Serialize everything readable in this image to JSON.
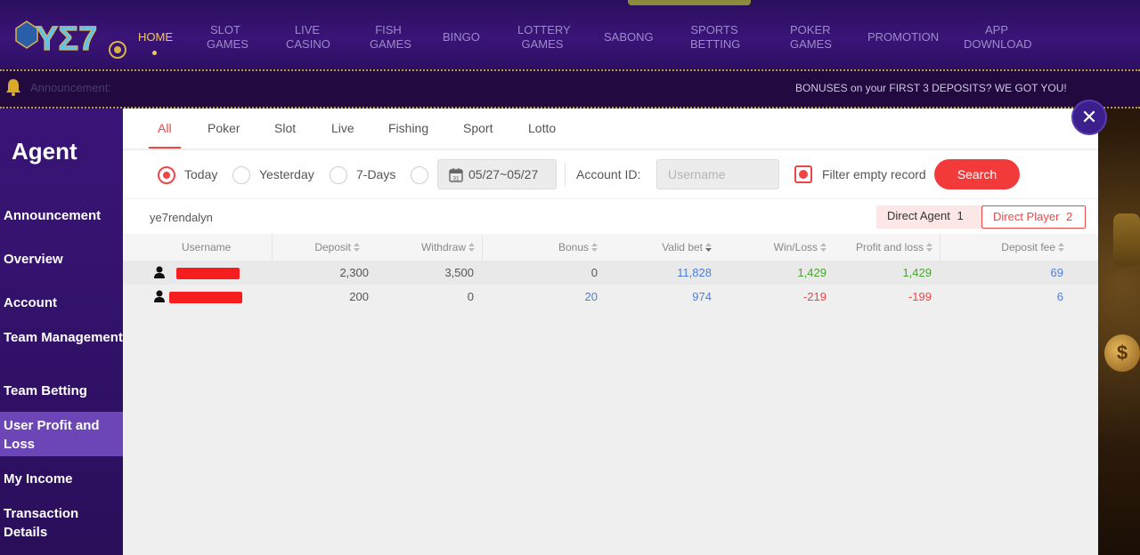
{
  "nav": {
    "items": [
      {
        "label": "HOME",
        "active": true
      },
      {
        "label": "SLOT GAMES"
      },
      {
        "label": "LIVE CASINO"
      },
      {
        "label": "FISH GAMES"
      },
      {
        "label": "BINGO"
      },
      {
        "label": "LOTTERY GAMES"
      },
      {
        "label": "SABONG"
      },
      {
        "label": "SPORTS BETTING"
      },
      {
        "label": "POKER GAMES"
      },
      {
        "label": "PROMOTION"
      },
      {
        "label": "APP DOWNLOAD"
      }
    ]
  },
  "announcement": {
    "label": "Announcement:",
    "text": "BONUSES on your FIRST 3 DEPOSITS? WE GOT YOU!"
  },
  "sidebar": {
    "title": "Agent",
    "items": [
      {
        "label": "Announcement"
      },
      {
        "label": "Overview"
      },
      {
        "label": "Account"
      },
      {
        "label": "Team Management"
      },
      {
        "label": "Team Betting"
      },
      {
        "label": "User Profit and Loss",
        "active": true
      },
      {
        "label": "My Income"
      },
      {
        "label": "Transaction Details"
      }
    ]
  },
  "tabs": [
    "All",
    "Poker",
    "Slot",
    "Live",
    "Fishing",
    "Sport",
    "Lotto"
  ],
  "filters": {
    "ranges": [
      "Today",
      "Yesterday",
      "7-Days"
    ],
    "selected_range": "Today",
    "date_range": "05/27~05/27",
    "account_label": "Account ID:",
    "account_placeholder": "Username",
    "filter_label": "Filter empty record",
    "filter_checked": true,
    "search_label": "Search"
  },
  "upline": "ye7rendalyn",
  "segments": {
    "agent_label": "Direct Agent",
    "agent_count": "1",
    "player_label": "Direct Player",
    "player_count": "2"
  },
  "table": {
    "headers": [
      "Username",
      "Deposit",
      "Withdraw",
      "Bonus",
      "Valid bet",
      "Win/Loss",
      "Profit and loss",
      "Deposit fee"
    ],
    "rows": [
      {
        "deposit": "2,300",
        "withdraw": "3,500",
        "bonus": "0",
        "valid_bet": "11,828",
        "win_loss": "1,429",
        "profit_loss": "1,429",
        "deposit_fee": "69"
      },
      {
        "deposit": "200",
        "withdraw": "0",
        "bonus": "20",
        "valid_bet": "974",
        "win_loss": "-219",
        "profit_loss": "-199",
        "deposit_fee": "6"
      }
    ]
  },
  "colors": {
    "accent": "#f04545",
    "nav_bg": "#3a1478",
    "sidebar_active": "#6c46b6",
    "positive": "#45a829",
    "link_blue": "#4d7ed9"
  }
}
